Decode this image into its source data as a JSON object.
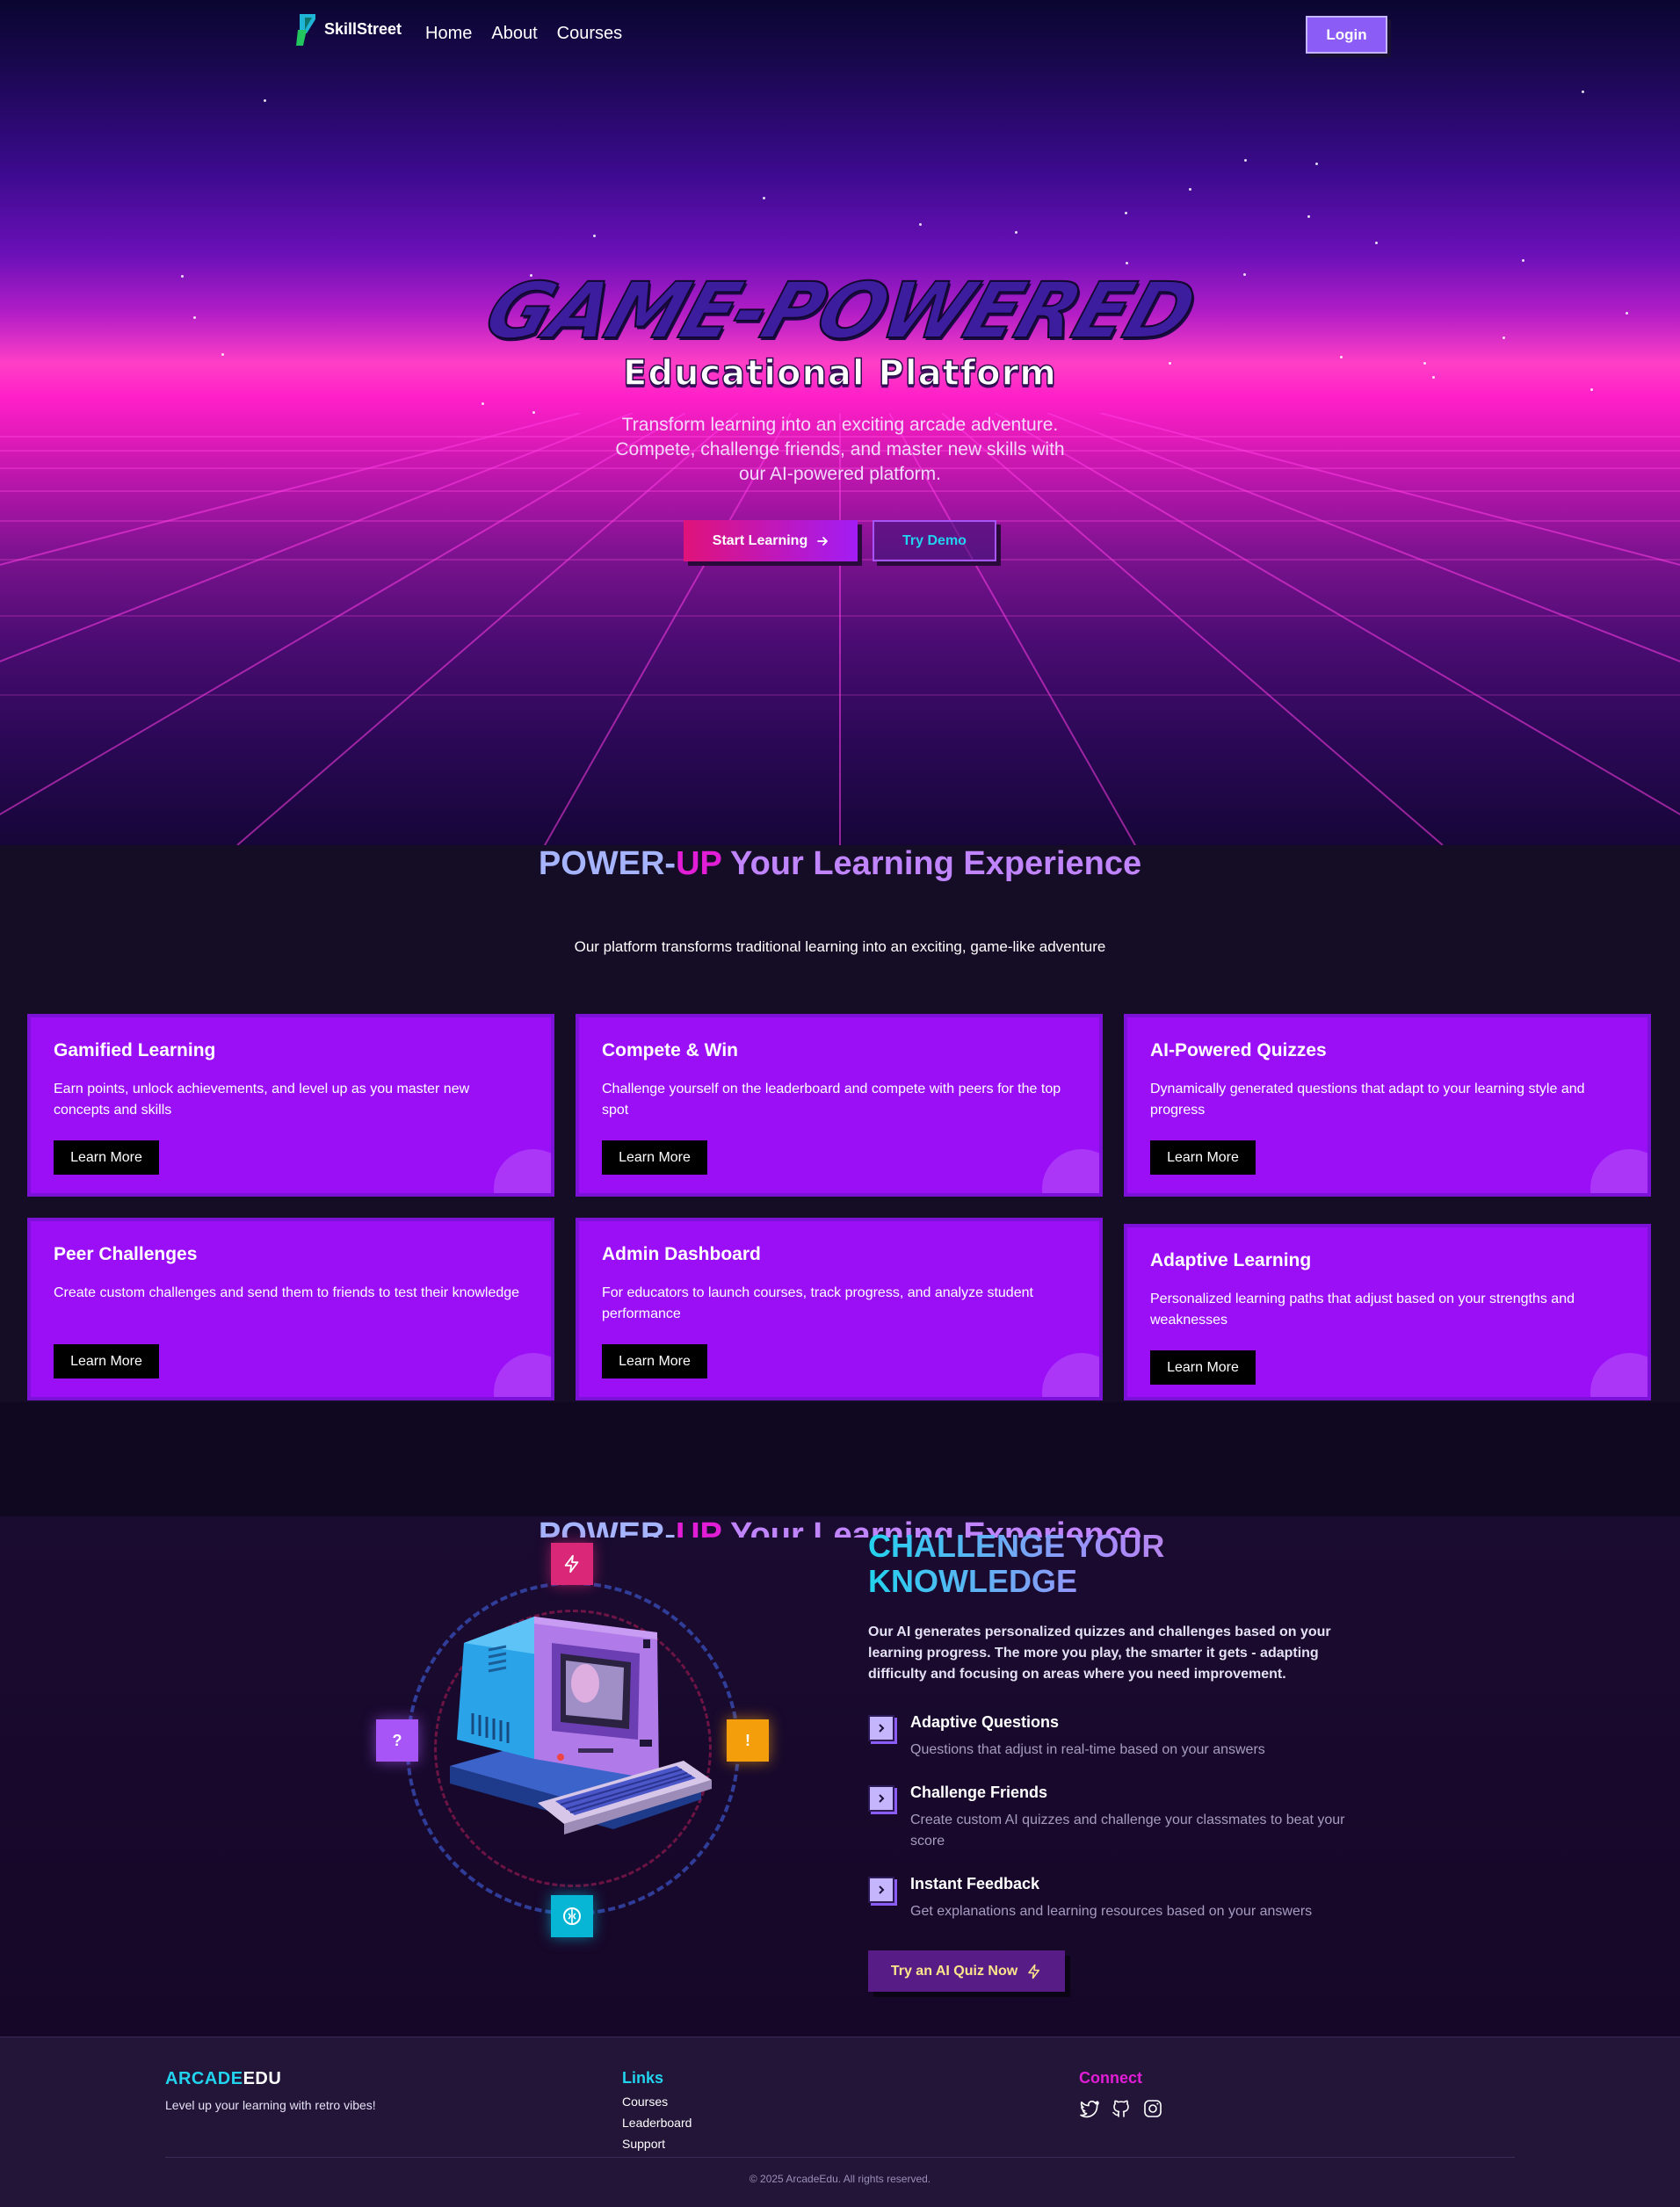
{
  "nav": {
    "logo_text": "SkillStreet",
    "links": [
      "Home",
      "About",
      "Courses"
    ],
    "login_label": "Login"
  },
  "hero": {
    "title": "GAME-POWERED",
    "subtitle": "Educational Platform",
    "description": "Transform learning into an exciting arcade adventure. Compete, challenge friends, and master new skills with our AI-powered platform.",
    "start_label": "Start Learning",
    "demo_label": "Try Demo"
  },
  "features": {
    "title_a": "POWER-",
    "title_b": "UP",
    "title_c": " Your Learning Experience",
    "description": "Our platform transforms traditional learning into an exciting, game-like adventure",
    "cards": [
      {
        "title": "Gamified Learning",
        "text": "Earn points, unlock achievements, and level up as you master new concepts and skills",
        "button": "Learn More"
      },
      {
        "title": "Compete & Win",
        "text": "Challenge yourself on the leaderboard and compete with peers for the top spot",
        "button": "Learn More"
      },
      {
        "title": "AI-Powered Quizzes",
        "text": "Dynamically generated questions that adapt to your learning style and progress",
        "button": "Learn More"
      },
      {
        "title": "Peer Challenges",
        "text": "Create custom challenges and send them to friends to test their knowledge",
        "button": "Learn More"
      },
      {
        "title": "Admin Dashboard",
        "text": "For educators to launch courses, track progress, and analyze student performance",
        "button": "Learn More"
      },
      {
        "title": "Adaptive Learning",
        "text": "Personalized learning paths that adjust based on your strengths and weaknesses",
        "button": "Learn More"
      }
    ]
  },
  "challenge": {
    "title": "CHALLENGE YOUR KNOWLEDGE",
    "description": "Our AI generates personalized quizzes and challenges based on your learning progress. The more you play, the smarter it gets - adapting difficulty and focusing on areas where you need improvement.",
    "orbit_labels": {
      "left": "?",
      "right": "!"
    },
    "features": [
      {
        "title": "Adaptive Questions",
        "text": "Questions that adjust in real-time based on your answers"
      },
      {
        "title": "Challenge Friends",
        "text": "Create custom AI quizzes and challenge your classmates to beat your score"
      },
      {
        "title": "Instant Feedback",
        "text": "Get explanations and learning resources based on your answers"
      }
    ],
    "cta_label": "Try an AI Quiz Now"
  },
  "footer": {
    "brand_a": "ARCADE",
    "brand_b": "EDU",
    "tagline": "Level up your learning with retro vibes!",
    "links_heading": "Links",
    "links": [
      "Courses",
      "Leaderboard",
      "Support"
    ],
    "connect_heading": "Connect",
    "copyright": "© 2025 ArcadeEdu. All rights reserved."
  },
  "colors": {
    "accent_purple": "#9b0ff7",
    "accent_magenta": "#e11dd6",
    "accent_cyan": "#22d3ee",
    "login_bg": "#8b5cf6"
  },
  "icons": [
    "arrow-right-icon",
    "lightning-icon",
    "chevron-right-icon",
    "brain-icon",
    "twitter-icon",
    "github-icon",
    "instagram-icon"
  ]
}
